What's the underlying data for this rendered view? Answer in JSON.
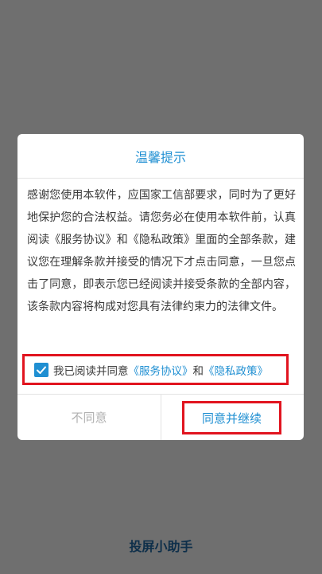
{
  "dialog": {
    "title": "温馨提示",
    "body": "感谢您使用本软件，应国家工信部要求，同时为了更好地保护您的合法权益。请您务必在使用本软件前，认真阅读《服务协议》和《隐私政策》里面的全部条款，建议您在理解条款并接受的情况下才点击同意，一旦您点击了同意，即表示您已经阅读并接受条款的全部内容，该条款内容将构成对您具有法律约束力的法律文件。",
    "consent": {
      "checked": true,
      "prefix": "我已阅读并同意",
      "service_link": "《服务协议》",
      "conjunction": "和",
      "privacy_link": "《隐私政策》"
    },
    "buttons": {
      "disagree": "不同意",
      "agree": "同意并继续"
    }
  },
  "app": {
    "name": "投屏小助手"
  },
  "colors": {
    "accent": "#1f8fd2",
    "highlight": "#e1141f",
    "overlay": "#6f6f6f"
  }
}
